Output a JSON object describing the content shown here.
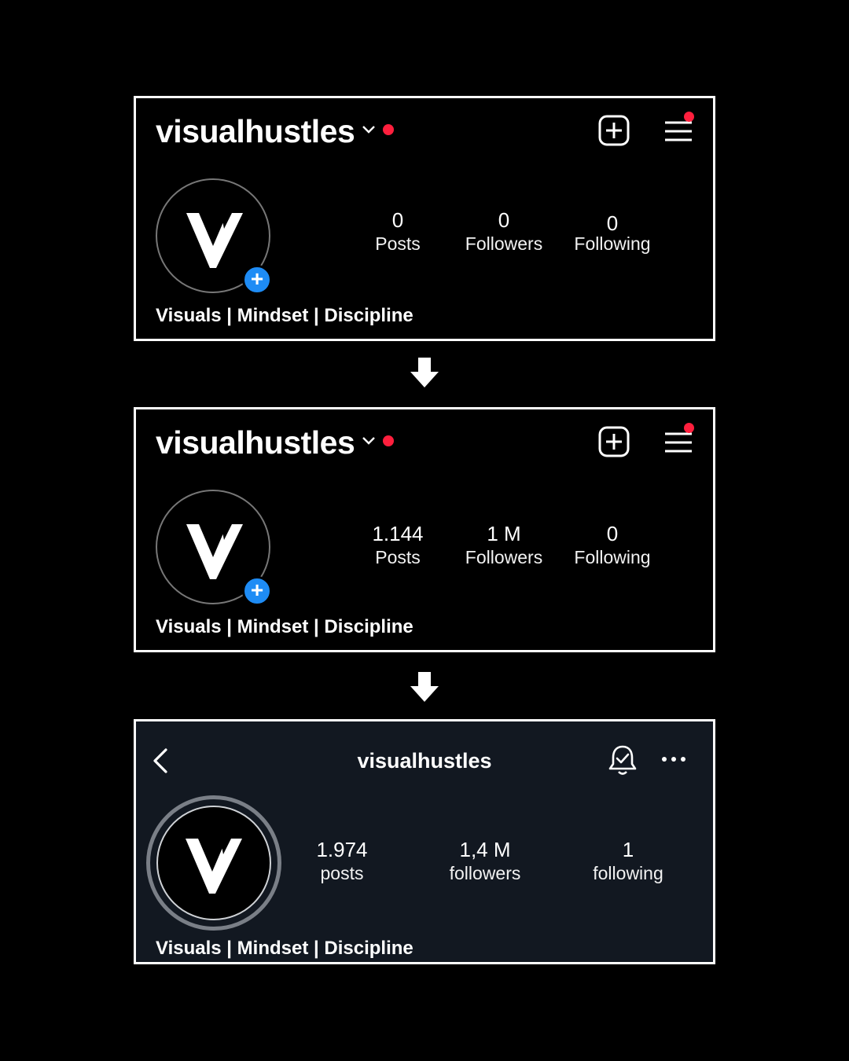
{
  "colors": {
    "background": "#000000",
    "accent_blue": "#1e8cf5",
    "notification_red": "#ff1f3d",
    "panel_dark": "#121821"
  },
  "panels": [
    {
      "username": "visualhustles",
      "stats": [
        {
          "num": "0",
          "label": "Posts"
        },
        {
          "num": "0",
          "label": "Followers"
        },
        {
          "num": "0",
          "label": "Following"
        }
      ],
      "bio": "Visuals | Mindset | Discipline",
      "icons": [
        "chevron-down-icon",
        "add-post-icon",
        "menu-icon"
      ]
    },
    {
      "username": "visualhustles",
      "stats": [
        {
          "num": "1.144",
          "label": "Posts"
        },
        {
          "num": "1 M",
          "label": "Followers"
        },
        {
          "num": "0",
          "label": "Following"
        }
      ],
      "bio": "Visuals | Mindset | Discipline",
      "icons": [
        "chevron-down-icon",
        "add-post-icon",
        "menu-icon"
      ]
    },
    {
      "username": "visualhustles",
      "stats": [
        {
          "num": "1.974",
          "label": "posts"
        },
        {
          "num": "1,4 M",
          "label": "followers"
        },
        {
          "num": "1",
          "label": "following"
        }
      ],
      "bio": "Visuals | Mindset | Discipline",
      "icons": [
        "back-icon",
        "bell-check-icon",
        "more-icon"
      ]
    }
  ]
}
